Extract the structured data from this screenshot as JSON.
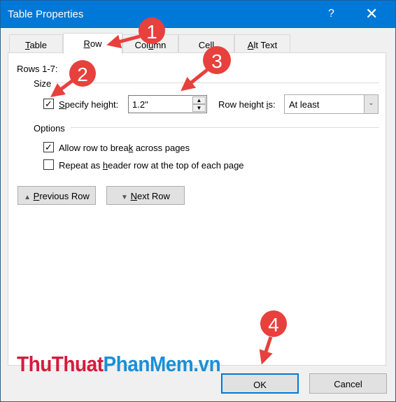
{
  "window": {
    "title": "Table Properties",
    "help": "?",
    "close": "✕"
  },
  "tabs": [
    {
      "label": "Table",
      "ul": "T",
      "rest": "able"
    },
    {
      "label": "Row",
      "ul": "R",
      "rest": "ow"
    },
    {
      "label": "Column",
      "pre": "Col",
      "ul": "u",
      "rest": "mn"
    },
    {
      "label": "Cell",
      "pre": "Ce",
      "ul": "l",
      "rest": "l"
    },
    {
      "label": "Alt Text",
      "ul": "A",
      "rest": "lt Text"
    }
  ],
  "row": {
    "rows_label": "Rows 1-7:",
    "size_label": "Size",
    "specify_height": {
      "ul": "S",
      "rest": "pecify height:",
      "checked": true
    },
    "height_value": "1.2\"",
    "row_height_is": {
      "pre": "Row height ",
      "ul": "i",
      "rest": "s:"
    },
    "row_height_select": "At least",
    "options_label": "Options",
    "allow_break": {
      "pre": "Allow row to brea",
      "ul": "k",
      "rest": " across pages",
      "checked": true
    },
    "repeat_header": {
      "pre": "Repeat as ",
      "ul": "h",
      "rest": "eader row at the top of each page",
      "checked": false
    },
    "previous_row": {
      "ul": "P",
      "rest": "revious Row"
    },
    "next_row": {
      "ul": "N",
      "rest": "ext Row"
    }
  },
  "footer": {
    "ok": "OK",
    "cancel": "Cancel"
  },
  "watermark": {
    "part1": "ThuThuat",
    "part2": "PhanMem",
    "part3": ".vn"
  },
  "annotations": [
    "1",
    "2",
    "3",
    "4"
  ],
  "colors": {
    "title": "#0078d7",
    "annotation": "#e8403c",
    "logo_red": "#d51c3c",
    "logo_blue": "#1a8fd8"
  }
}
